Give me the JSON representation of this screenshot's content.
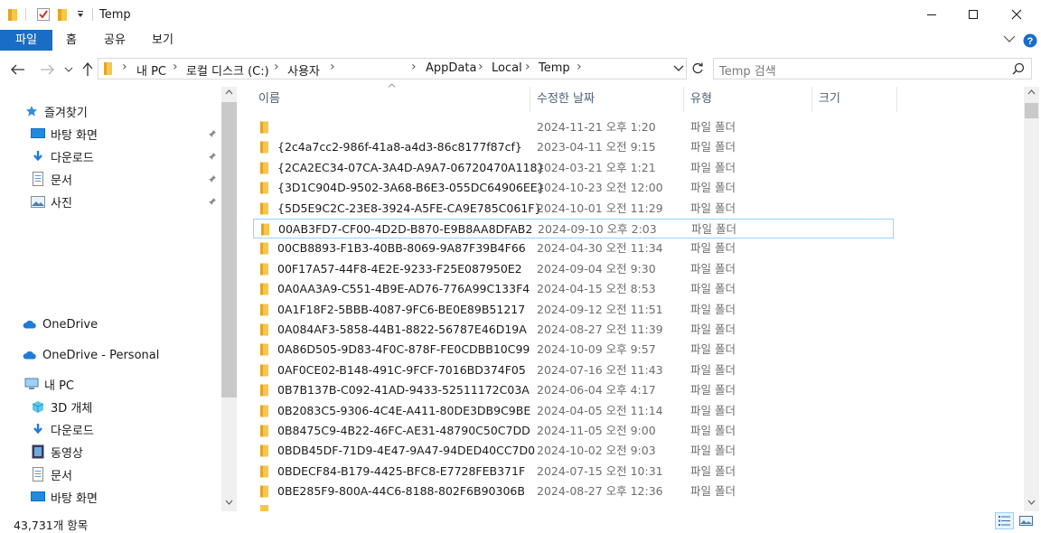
{
  "window": {
    "title": "Temp"
  },
  "ribbon": {
    "tabs": [
      "파일",
      "홈",
      "공유",
      "보기"
    ]
  },
  "address": {
    "crumbs": [
      "내 PC",
      "로컬 디스크 (C:)",
      "사용자",
      "AppData",
      "Local",
      "Temp"
    ]
  },
  "search": {
    "placeholder": "Temp 검색"
  },
  "nav": {
    "quick_access": "즐겨찾기",
    "quick_items": [
      "바탕 화면",
      "다운로드",
      "문서",
      "사진"
    ],
    "onedrive": "OneDrive",
    "onedrive_personal": "OneDrive - Personal",
    "this_pc": "내 PC",
    "pc_items": [
      "3D 개체",
      "다운로드",
      "동영상",
      "문서",
      "바탕 화면"
    ]
  },
  "columns": {
    "name": "이름",
    "date": "수정한 날짜",
    "type": "유형",
    "size": "크기"
  },
  "files": [
    {
      "name": "",
      "date": "2024-11-21 오후 1:20",
      "type": "파일 폴더"
    },
    {
      "name": "{2c4a7cc2-986f-41a8-a4d3-86c8177f87cf}",
      "date": "2023-04-11 오전 9:15",
      "type": "파일 폴더"
    },
    {
      "name": "{2CA2EC34-07CA-3A4D-A9A7-06720470A118}",
      "date": "2024-03-21 오후 1:21",
      "type": "파일 폴더"
    },
    {
      "name": "{3D1C904D-9502-3A68-B6E3-055DC64906EE}",
      "date": "2024-10-23 오전 12:00",
      "type": "파일 폴더"
    },
    {
      "name": "{5D5E9C2C-23E8-3924-A5FE-CA9E785C061F}",
      "date": "2024-10-01 오전 11:29",
      "type": "파일 폴더"
    },
    {
      "name": "00AB3FD7-CF00-4D2D-B870-E9B8AA8DFAB2",
      "date": "2024-09-10 오후 2:03",
      "type": "파일 폴더"
    },
    {
      "name": "00CB8893-F1B3-40BB-8069-9A87F39B4F66",
      "date": "2024-04-30 오전 11:34",
      "type": "파일 폴더"
    },
    {
      "name": "00F17A57-44F8-4E2E-9233-F25E087950E2",
      "date": "2024-09-04 오전 9:30",
      "type": "파일 폴더"
    },
    {
      "name": "0A0AA3A9-C551-4B9E-AD76-776A99C133F4",
      "date": "2024-04-15 오전 8:53",
      "type": "파일 폴더"
    },
    {
      "name": "0A1F18F2-5BBB-4087-9FC6-BE0E89B51217",
      "date": "2024-09-12 오전 11:51",
      "type": "파일 폴더"
    },
    {
      "name": "0A084AF3-5858-44B1-8822-56787E46D19A",
      "date": "2024-08-27 오전 11:39",
      "type": "파일 폴더"
    },
    {
      "name": "0A86D505-9D83-4F0C-878F-FE0CDBB10C99",
      "date": "2024-10-09 오후 9:57",
      "type": "파일 폴더"
    },
    {
      "name": "0AF0CE02-B148-491C-9FCF-7016BD374F05",
      "date": "2024-07-16 오전 11:43",
      "type": "파일 폴더"
    },
    {
      "name": "0B7B137B-C092-41AD-9433-52511172C03A",
      "date": "2024-06-04 오후 4:17",
      "type": "파일 폴더"
    },
    {
      "name": "0B2083C5-9306-4C4E-A411-80DE3DB9C9BE",
      "date": "2024-04-05 오전 11:14",
      "type": "파일 폴더"
    },
    {
      "name": "0B8475C9-4B22-46FC-AE31-48790C50C7DD",
      "date": "2024-11-05 오전 9:00",
      "type": "파일 폴더"
    },
    {
      "name": "0BDB45DF-71D9-4E47-9A47-94DED40CC7D0",
      "date": "2024-10-02 오전 9:03",
      "type": "파일 폴더"
    },
    {
      "name": "0BDECF84-B179-4425-BFC8-E7728FEB371F",
      "date": "2024-07-15 오전 10:31",
      "type": "파일 폴더"
    },
    {
      "name": "0BE285F9-800A-44C6-8188-802F6B90306B",
      "date": "2024-08-27 오후 12:36",
      "type": "파일 폴더"
    }
  ],
  "status": {
    "item_count": "43,731개 항목"
  },
  "colors": {
    "accent": "#1a6dc4",
    "folder": "#f8c64a",
    "selection": "#99d1ff"
  }
}
